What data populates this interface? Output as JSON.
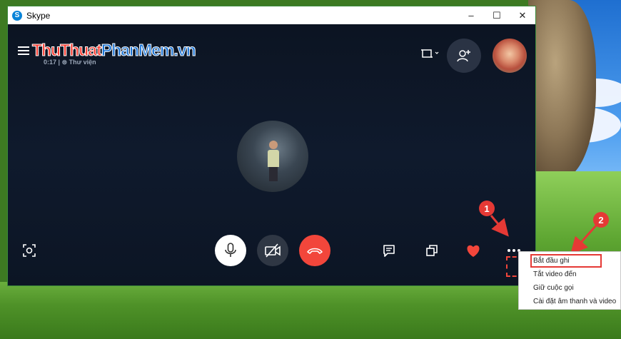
{
  "window": {
    "title": "Skype",
    "app_icon_letter": "S",
    "controls": {
      "minimize": "–",
      "maximize": "☐",
      "close": "✕"
    }
  },
  "call": {
    "watermark_part1": "ThuThuat",
    "watermark_part2": "PhanMem.vn",
    "duration": "0:17",
    "separator": "|",
    "library_label": "Thư viện"
  },
  "context_menu": {
    "items": [
      "Bắt đầu ghi",
      "Tắt video đến",
      "Giữ cuộc gọi",
      "Cài đặt âm thanh và video"
    ]
  },
  "annotations": {
    "step1": "1",
    "step2": "2"
  },
  "colors": {
    "hangup": "#f2463b",
    "accent_annotation": "#e53935",
    "call_background": "#0d1726",
    "skype_blue": "#0a84d8"
  }
}
